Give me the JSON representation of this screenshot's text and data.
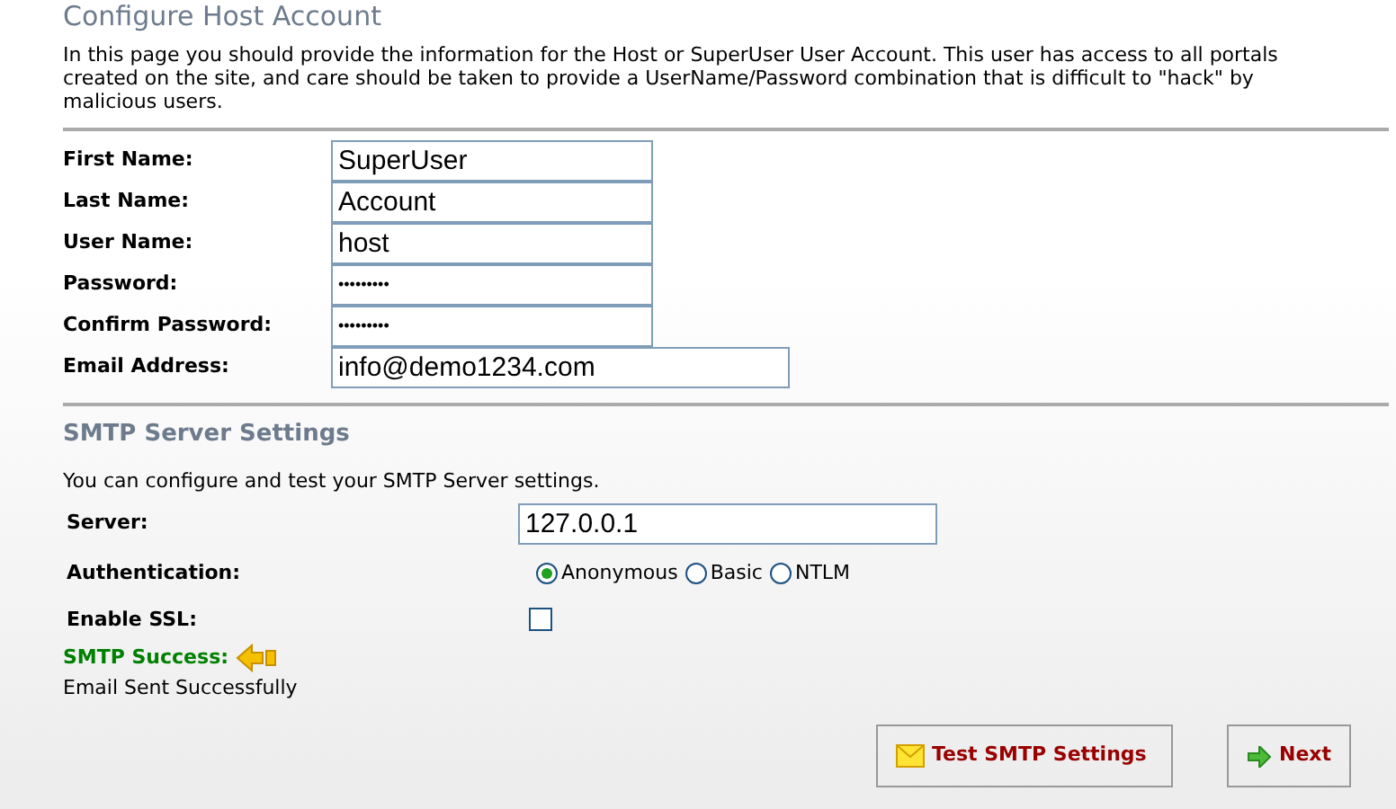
{
  "title": "Configure Host Account",
  "intro": "In this page you should provide the information for the Host or SuperUser User Account. This user has access to all portals created on the site, and care should be taken to provide a UserName/Password combination that is difficult to \"hack\" by malicious users.",
  "account_fields": [
    {
      "label": "First Name:",
      "value": "SuperUser",
      "kind": "text"
    },
    {
      "label": "Last Name:",
      "value": "Account",
      "kind": "text"
    },
    {
      "label": "User Name:",
      "value": "host",
      "kind": "text"
    },
    {
      "label": "Password:",
      "value": "•••••••••",
      "kind": "password"
    },
    {
      "label": "Confirm Password:",
      "value": "•••••••••",
      "kind": "password"
    },
    {
      "label": "Email Address:",
      "value": "info@demo1234.com",
      "kind": "wide"
    }
  ],
  "smtp": {
    "heading": "SMTP Server Settings",
    "description": "You can configure and test your SMTP Server settings.",
    "server": {
      "label": "Server:",
      "value": "127.0.0.1"
    },
    "authentication": {
      "label": "Authentication:",
      "options": [
        {
          "label": "Anonymous",
          "selected": true
        },
        {
          "label": "Basic",
          "selected": false
        },
        {
          "label": "NTLM",
          "selected": false
        }
      ]
    },
    "ssl": {
      "label": "Enable SSL:",
      "checked": false
    },
    "result": {
      "title": "SMTP Success:",
      "message": "Email Sent Successfully"
    }
  },
  "buttons": [
    {
      "label": "Test SMTP Settings",
      "kind": "mail"
    },
    {
      "label": "Next",
      "kind": "next"
    }
  ]
}
